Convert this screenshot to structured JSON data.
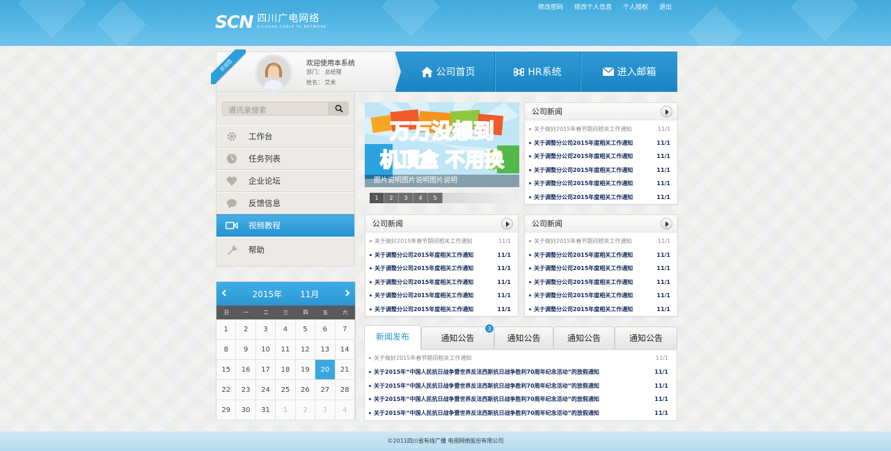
{
  "header": {
    "logo_mark": "SCN",
    "logo_cn": "四川广电网络",
    "logo_en": "SICHUAN CABLE TV NETWORK",
    "links": [
      "修改密码",
      "修改个人信息",
      "个人授权",
      "退出"
    ]
  },
  "profile": {
    "ribbon": "欢迎您",
    "welcome": "欢迎使用本系统",
    "dept": "部门：  总经理",
    "name": "姓名：  艾米"
  },
  "nav": {
    "items": [
      {
        "label": "公司首页",
        "icon": "home-icon"
      },
      {
        "label": "HR系统",
        "icon": "command-icon"
      },
      {
        "label": "进入邮箱",
        "icon": "mail-icon"
      }
    ]
  },
  "sidebar": {
    "search_placeholder": "通讯录搜索",
    "menu": [
      {
        "label": "工作台",
        "icon": "gear-icon"
      },
      {
        "label": "任务列表",
        "icon": "clock-icon"
      },
      {
        "label": "企业论坛",
        "icon": "heart-icon"
      },
      {
        "label": "反馈信息",
        "icon": "chat-icon"
      },
      {
        "label": "视频教程",
        "icon": "video-icon",
        "active": true
      },
      {
        "label": "帮助",
        "icon": "wrench-icon"
      }
    ]
  },
  "calendar": {
    "year": "2015年",
    "month": "11月",
    "weekdays": [
      "日",
      "一",
      "二",
      "三",
      "四",
      "五",
      "六"
    ],
    "days": [
      "1",
      "2",
      "3",
      "4",
      "5",
      "6",
      "7",
      "8",
      "9",
      "10",
      "11",
      "12",
      "13",
      "14",
      "15",
      "16",
      "17",
      "18",
      "19",
      "20",
      "21",
      "22",
      "23",
      "24",
      "25",
      "26",
      "27",
      "28",
      "29",
      "30",
      "31",
      "1",
      "2",
      "3",
      "4"
    ],
    "today": "20"
  },
  "banner": {
    "line1": "万万没想到",
    "line2": "机顶盒 不用换",
    "caption": "图片说明图片说明图片说明",
    "pages": [
      "1",
      "2",
      "3",
      "4",
      "5"
    ]
  },
  "panels": [
    {
      "title": "公司新闻",
      "items": [
        {
          "text": "关于做好2015年春节期间相关工作通知",
          "date": "11/1"
        },
        {
          "text": "关于调整分公司2015年度相关工作通知",
          "date": "11/1"
        },
        {
          "text": "关于调整分公司2015年度相关工作通知",
          "date": "11/1"
        },
        {
          "text": "关于调整分公司2015年度相关工作通知",
          "date": "11/1"
        },
        {
          "text": "关于调整分公司2015年度相关工作通知",
          "date": "11/1"
        },
        {
          "text": "关于调整分公司2015年度相关工作通知",
          "date": "11/1"
        }
      ]
    },
    {
      "title": "公司新闻",
      "items": [
        {
          "text": "关于做好2015年春节期间相关工作通知",
          "date": "11/1"
        },
        {
          "text": "关于调整分公司2015年度相关工作通知",
          "date": "11/1"
        },
        {
          "text": "关于调整分公司2015年度相关工作通知",
          "date": "11/1"
        },
        {
          "text": "关于调整分公司2015年度相关工作通知",
          "date": "11/1"
        },
        {
          "text": "关于调整分公司2015年度相关工作通知",
          "date": "11/1"
        },
        {
          "text": "关于调整分公司2015年度相关工作通知",
          "date": "11/1"
        }
      ]
    },
    {
      "title": "公司新闻",
      "items": [
        {
          "text": "关于做好2015年春节期间相关工作通知",
          "date": "11/1"
        },
        {
          "text": "关于调整分公司2015年度相关工作通知",
          "date": "11/1"
        },
        {
          "text": "关于调整分公司2015年度相关工作通知",
          "date": "11/1"
        },
        {
          "text": "关于调整分公司2015年度相关工作通知",
          "date": "11/1"
        },
        {
          "text": "关于调整分公司2015年度相关工作通知",
          "date": "11/1"
        },
        {
          "text": "关于调整分公司2015年度相关工作通知",
          "date": "11/1"
        }
      ]
    }
  ],
  "tabs": {
    "items": [
      "新闻发布",
      "通知公告",
      "通知公告",
      "通知公告",
      "通知公告"
    ],
    "badge": "3",
    "rows": [
      {
        "text": "关于做好2015年春节期间相关工作通知",
        "date": "11/1"
      },
      {
        "text": "关于2015年“中国人民抗日战争暨世界反法西斯抗日战争胜利70周年纪念活动”的放假通知",
        "date": "11/1"
      },
      {
        "text": "关于2015年“中国人民抗日战争暨世界反法西斯抗日战争胜利70周年纪念活动”的放假通知",
        "date": "11/1"
      },
      {
        "text": "关于2015年“中国人民抗日战争暨世界反法西斯抗日战争胜利70周年纪念活动”的放假通知",
        "date": "11/1"
      },
      {
        "text": "关于2015年“中国人民抗日战争暨世界反法西斯抗日战争胜利70周年纪念活动”的放假通知",
        "date": "11/1"
      }
    ]
  },
  "footer": {
    "text": "©2011四川省有线广播 电视网络股份有限公司"
  }
}
